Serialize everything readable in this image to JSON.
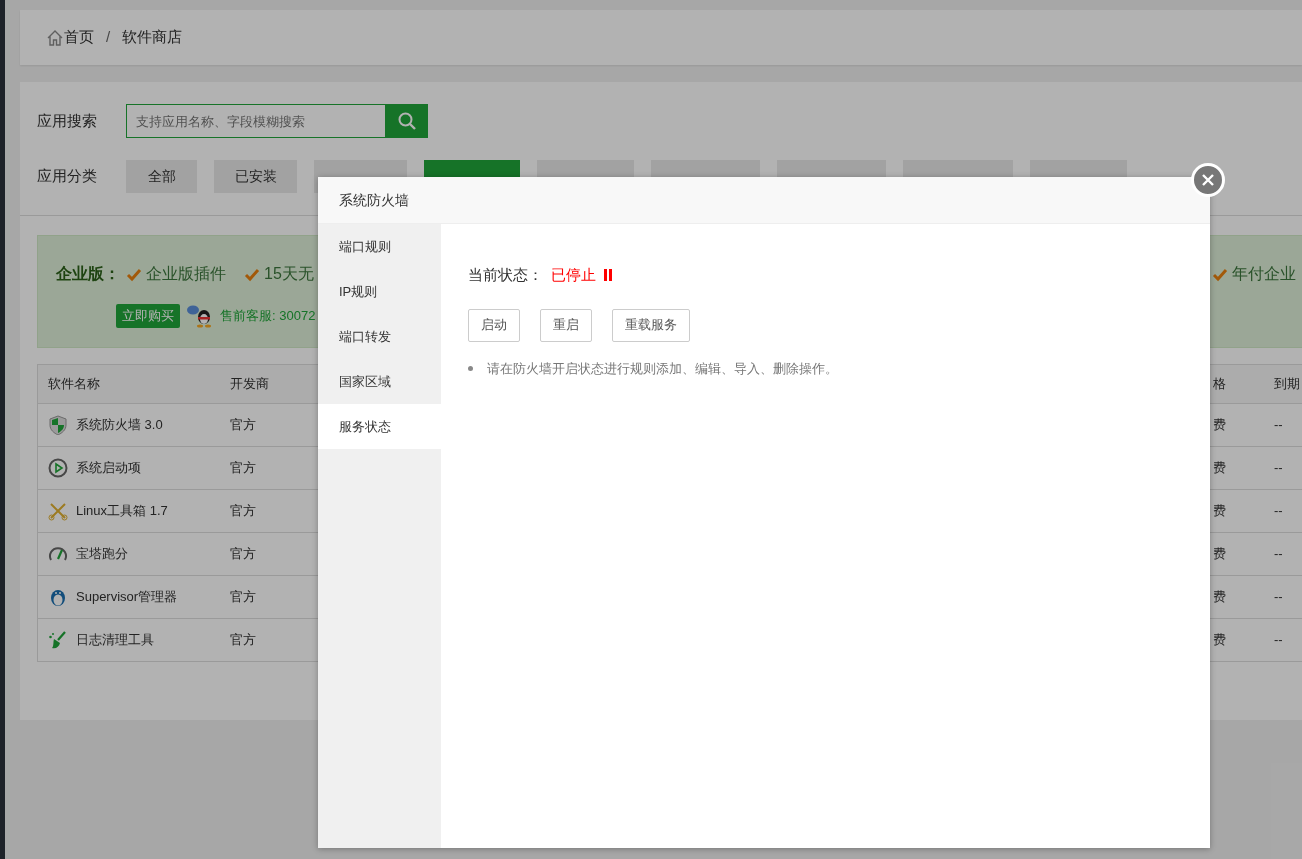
{
  "breadcrumb": [
    {
      "label": "首页"
    },
    {
      "label": "软件商店"
    }
  ],
  "breadcrumb_separator": "/",
  "search": {
    "label": "应用搜索",
    "placeholder": "支持应用名称、字段模糊搜索"
  },
  "categories": {
    "label": "应用分类",
    "items": [
      {
        "label": "全部",
        "selected": false
      },
      {
        "label": "已安装",
        "selected": false
      },
      {
        "selected": false
      },
      {
        "selected": true
      },
      {
        "selected": false
      },
      {
        "selected": false
      },
      {
        "selected": false
      },
      {
        "selected": false
      },
      {
        "selected": false
      }
    ]
  },
  "banner": {
    "title": "企业版：",
    "features": [
      "企业版插件",
      "15天无"
    ],
    "right_feature": "年付企业",
    "buy_button": "立即购买",
    "service": "售前客服: 30072"
  },
  "table": {
    "columns": [
      "软件名称",
      "开发商",
      "格",
      "到期"
    ],
    "rows": [
      {
        "name": "系统防火墙 3.0",
        "developer": "官方",
        "price": "费",
        "expiry": "--"
      },
      {
        "name": "系统启动项",
        "developer": "官方",
        "price": "费",
        "expiry": "--"
      },
      {
        "name": "Linux工具箱 1.7",
        "developer": "官方",
        "price": "费",
        "expiry": "--"
      },
      {
        "name": "宝塔跑分",
        "developer": "官方",
        "price": "费",
        "expiry": "--"
      },
      {
        "name": "Supervisor管理器",
        "developer": "官方",
        "price": "费",
        "expiry": "--"
      },
      {
        "name": "日志清理工具",
        "developer": "官方",
        "price": "费",
        "expiry": "--"
      }
    ]
  },
  "dialog": {
    "title": "系统防火墙",
    "nav": [
      {
        "label": "端口规则",
        "selected": false
      },
      {
        "label": "IP规则",
        "selected": false
      },
      {
        "label": "端口转发",
        "selected": false
      },
      {
        "label": "国家区域",
        "selected": false
      },
      {
        "label": "服务状态",
        "selected": true
      }
    ],
    "status": {
      "label": "当前状态：",
      "value": "已停止",
      "running": false
    },
    "buttons": [
      "启动",
      "重启",
      "重载服务"
    ],
    "notes": [
      "请在防火墙开启状态进行规则添加、编辑、导入、删除操作。"
    ]
  }
}
